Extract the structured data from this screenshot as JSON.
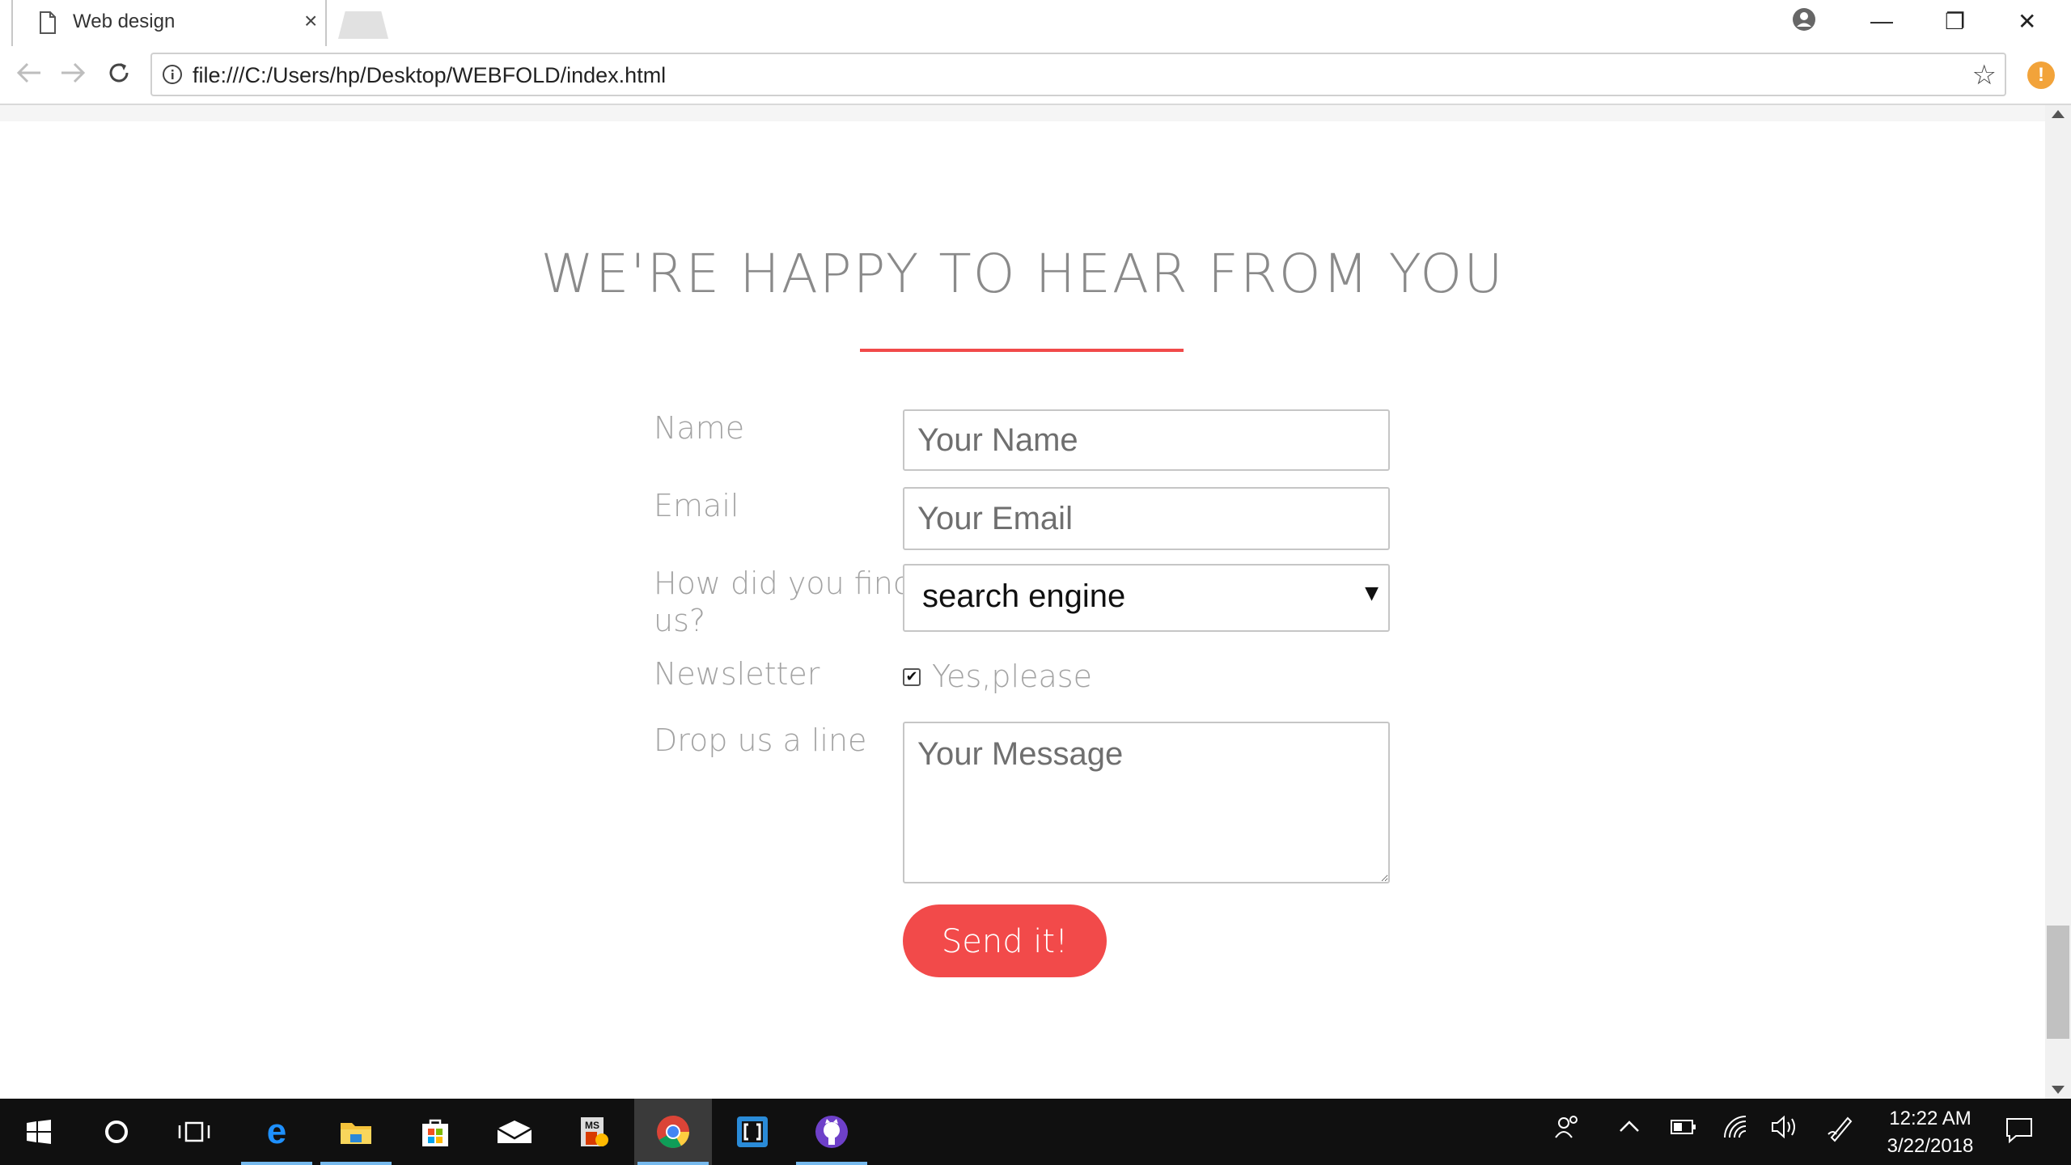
{
  "browser": {
    "tab_title": "Web design",
    "tab_close": "×",
    "url": "file:///C:/Users/hp/Desktop/WEBFOLD/index.html",
    "window_controls": {
      "minimize": "—",
      "restore": "❐",
      "close": "✕"
    }
  },
  "page": {
    "heading": "WE'RE HAPPY TO HEAR FROM YOU",
    "accent_color": "#f14a4a",
    "form": {
      "name_label": "Name",
      "name_placeholder": "Your Name",
      "email_label": "Email",
      "email_placeholder": "Your Email",
      "source_label_line1": "How did you find",
      "source_label_line2": "us?",
      "source_selected": "search engine",
      "newsletter_label": "Newsletter",
      "newsletter_checked": true,
      "newsletter_option": "Yes,please",
      "message_label": "Drop us a line",
      "message_placeholder": "Your Message",
      "submit_label": "Send it!"
    }
  },
  "taskbar": {
    "apps": [
      "start-icon",
      "cortana-icon",
      "task-view-icon",
      "edge-icon",
      "file-explorer-icon",
      "store-icon",
      "mail-icon",
      "msoffice-icon",
      "chrome-icon",
      "brackets-icon",
      "github-icon"
    ],
    "active_app": "chrome-icon",
    "clock_time": "12:22 AM",
    "clock_date": "3/22/2018"
  }
}
